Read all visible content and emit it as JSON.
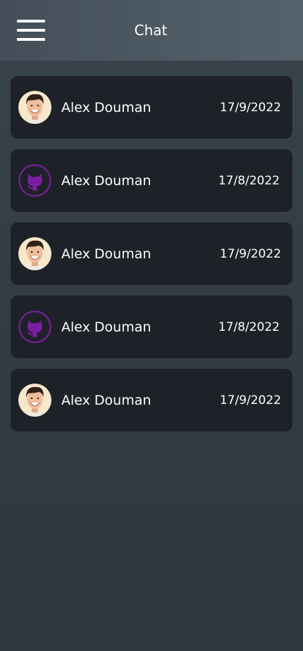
{
  "header": {
    "title": "Chat",
    "menu_icon": "hamburger-menu-icon"
  },
  "chats": [
    {
      "name": "Alex Douman",
      "date": "17/9/2022",
      "avatar": "person-photo"
    },
    {
      "name": "Alex Douman",
      "date": "17/8/2022",
      "avatar": "github-octocat-icon"
    },
    {
      "name": "Alex Douman",
      "date": "17/9/2022",
      "avatar": "person-photo"
    },
    {
      "name": "Alex Douman",
      "date": "17/8/2022",
      "avatar": "github-octocat-icon"
    },
    {
      "name": "Alex Douman",
      "date": "17/9/2022",
      "avatar": "person-photo"
    }
  ],
  "colors": {
    "header_background": "#4d5963",
    "page_background": "#343c44",
    "card_background": "#1e2228",
    "text": "#ffffff",
    "github_icon": "#7b1fa2"
  }
}
